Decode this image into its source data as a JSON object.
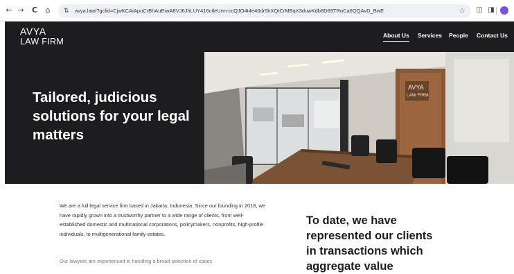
{
  "browser": {
    "url": "avya.law/?gclid=CjwKCAiApuCrBhAuEiwA8VJ6JhLUY416ctleUnn-ccQJO4t4e46dr5hXQtCrMBqX3duwKdb8D69TRoCa6QQAvD_BwE",
    "back_icon": "arrow-left-icon",
    "forward_icon": "arrow-right-icon",
    "reload_icon": "reload-icon",
    "home_icon": "home-icon",
    "back": "←",
    "forward": "→",
    "reload": "C",
    "home": "⌂",
    "tune": "⇅",
    "star": "☆",
    "ext": "◫",
    "sidepanel": "◨"
  },
  "header": {
    "logo_line1": "AVYA",
    "logo_line2": "LAW FIRM",
    "nav": [
      {
        "label": "About Us",
        "active": true
      },
      {
        "label": "Services",
        "active": false
      },
      {
        "label": "People",
        "active": false
      },
      {
        "label": "Contact Us",
        "active": false
      }
    ]
  },
  "hero": {
    "headline": "Tailored, judicious solutions for your legal matters",
    "sign_line1": "AVYA",
    "sign_line2": "LAW FIRM"
  },
  "about": {
    "paragraph": "We are a full legal service firm based in Jakarta, Indonesia. Since our founding in 2018, we have rapidly grown into a trustworthy partner to a wide range of clients, from well-established domestic and multinational corporations, policymakers, nonprofits, high-profile individuals, to multigenerational family estates.",
    "paragraph2_partial": "Our lawyers are experienced in handling a broad selection of cases"
  },
  "stats": {
    "heading": "To date, we have represented our clients in transactions which aggregate value"
  },
  "colors": {
    "dark": "#1d1d1f",
    "profile": "#7b53d8"
  }
}
